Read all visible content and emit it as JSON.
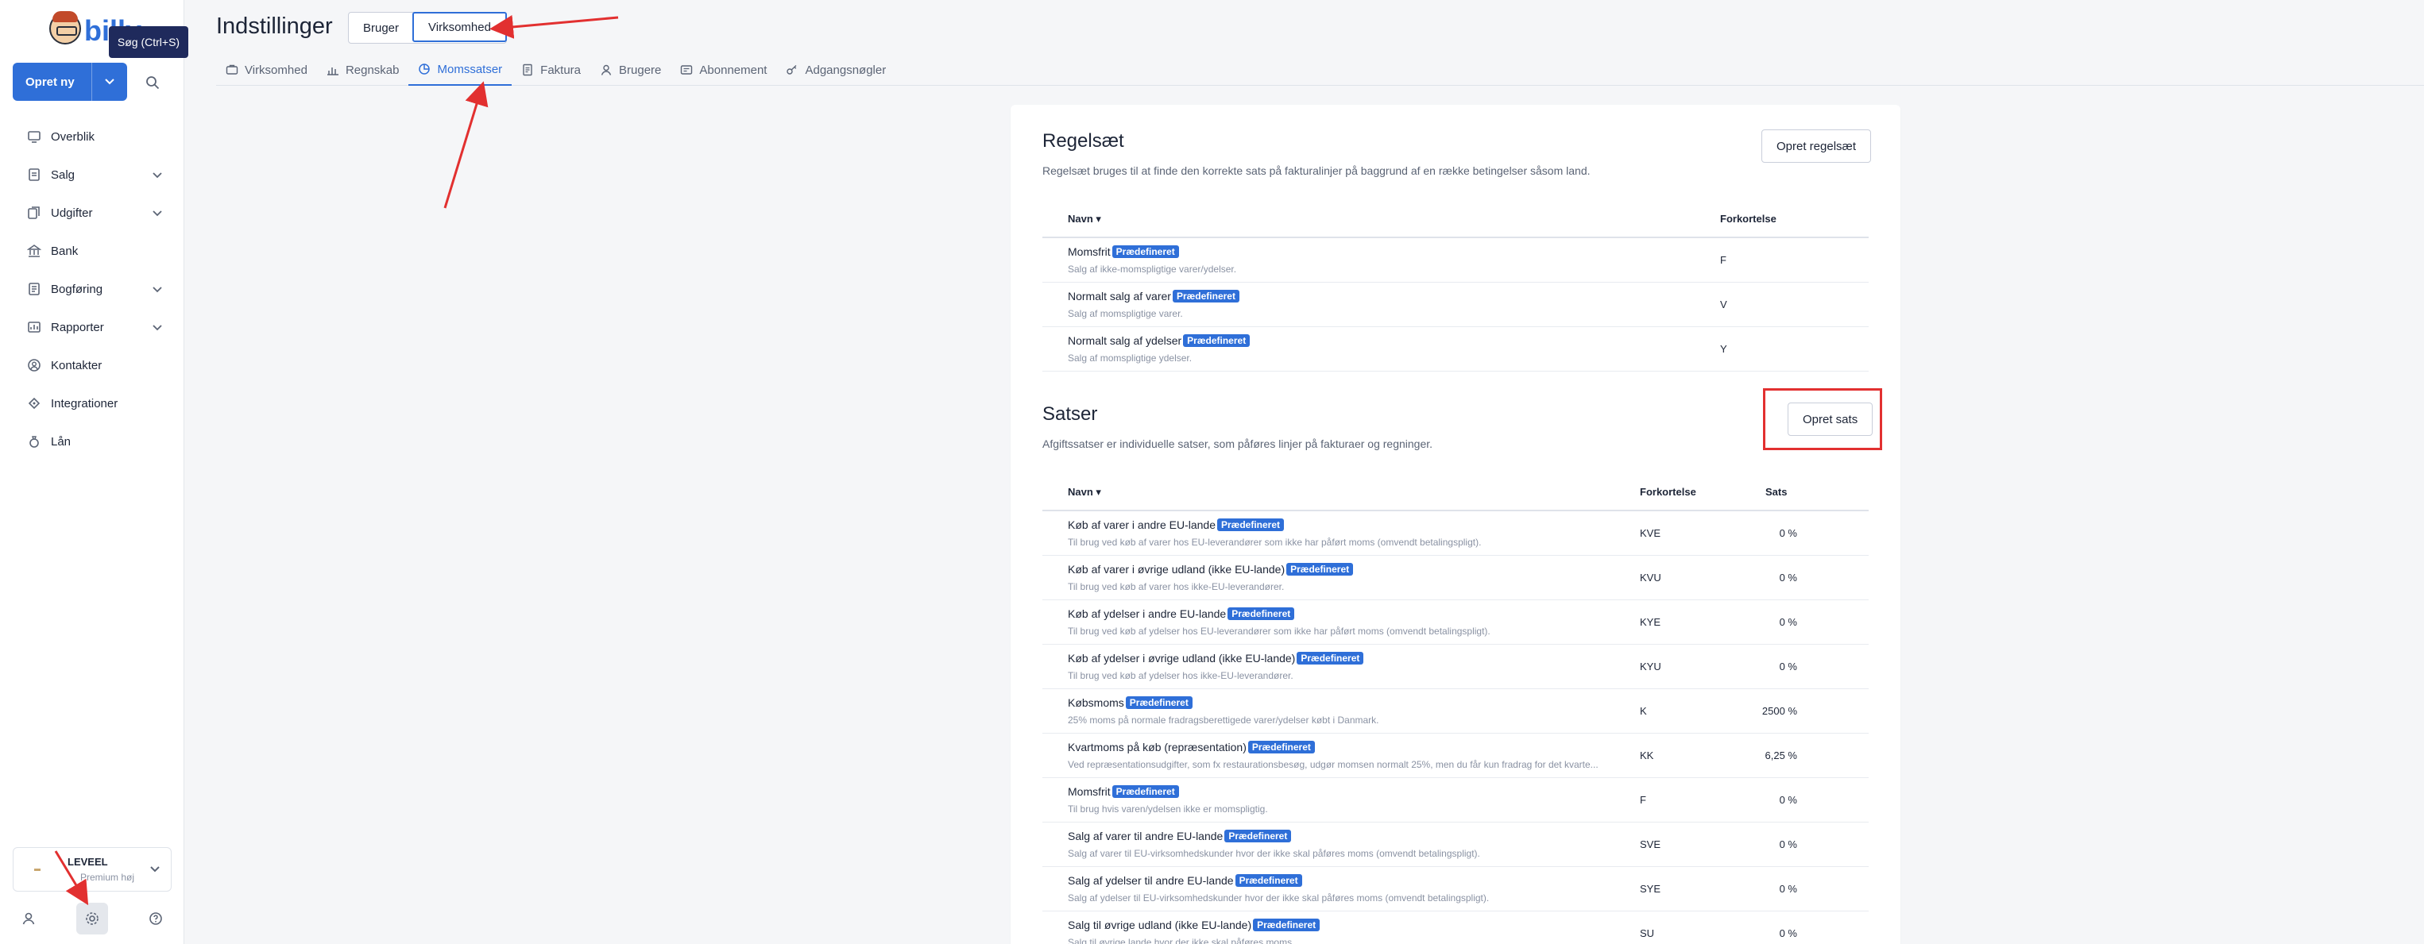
{
  "app": {
    "logo_text": "billy",
    "tooltip": "Søg (Ctrl+S)",
    "create_button": "Opret ny",
    "nav": [
      {
        "label": "Overblik",
        "icon": "overview-icon",
        "chevron": false
      },
      {
        "label": "Salg",
        "icon": "sales-icon",
        "chevron": true
      },
      {
        "label": "Udgifter",
        "icon": "expenses-icon",
        "chevron": true
      },
      {
        "label": "Bank",
        "icon": "bank-icon",
        "chevron": false
      },
      {
        "label": "Bogføring",
        "icon": "bookkeeping-icon",
        "chevron": true
      },
      {
        "label": "Rapporter",
        "icon": "reports-icon",
        "chevron": true
      },
      {
        "label": "Kontakter",
        "icon": "contacts-icon",
        "chevron": false
      },
      {
        "label": "Integrationer",
        "icon": "integrations-icon",
        "chevron": false
      },
      {
        "label": "Lån",
        "icon": "loan-icon",
        "chevron": false
      }
    ],
    "company": {
      "name": "LEVEEL",
      "plan": "Premium høj"
    }
  },
  "header": {
    "title": "Indstillinger",
    "scope_tabs": [
      {
        "label": "Bruger",
        "active": false
      },
      {
        "label": "Virksomhed",
        "active": true
      }
    ],
    "tabs": [
      {
        "label": "Virksomhed",
        "icon": "briefcase-icon",
        "active": false
      },
      {
        "label": "Regnskab",
        "icon": "chart-bars-icon",
        "active": false
      },
      {
        "label": "Momssatser",
        "icon": "pie-chart-icon",
        "active": true
      },
      {
        "label": "Faktura",
        "icon": "invoice-icon",
        "active": false
      },
      {
        "label": "Brugere",
        "icon": "user-icon",
        "active": false
      },
      {
        "label": "Abonnement",
        "icon": "subscription-icon",
        "active": false
      },
      {
        "label": "Adgangsnøgler",
        "icon": "key-icon",
        "active": false
      }
    ]
  },
  "rulesets": {
    "title": "Regelsæt",
    "description": "Regelsæt bruges til at finde den korrekte sats på fakturalinjer på baggrund af en række betingelser såsom land.",
    "button": "Opret regelsæt",
    "columns": {
      "name": "Navn",
      "abbr": "Forkortelse"
    },
    "rows": [
      {
        "name": "Momsfrit",
        "badge": "Prædefineret",
        "desc": "Salg af ikke-momspligtige varer/ydelser.",
        "abbr": "F"
      },
      {
        "name": "Normalt salg af varer",
        "badge": "Prædefineret",
        "desc": "Salg af momspligtige varer.",
        "abbr": "V"
      },
      {
        "name": "Normalt salg af ydelser",
        "badge": "Prædefineret",
        "desc": "Salg af momspligtige ydelser.",
        "abbr": "Y"
      }
    ]
  },
  "rates": {
    "title": "Satser",
    "description": "Afgiftssatser er individuelle satser, som påføres linjer på fakturaer og regninger.",
    "button": "Opret sats",
    "columns": {
      "name": "Navn",
      "abbr": "Forkortelse",
      "rate": "Sats"
    },
    "rows": [
      {
        "name": "Køb af varer i andre EU-lande",
        "badge": "Prædefineret",
        "desc": "Til brug ved køb af varer hos EU-leverandører som ikke har påført moms (omvendt betalingspligt).",
        "abbr": "KVE",
        "rate": "0 %"
      },
      {
        "name": "Køb af varer i øvrige udland (ikke EU-lande)",
        "badge": "Prædefineret",
        "desc": "Til brug ved køb af varer hos ikke-EU-leverandører.",
        "abbr": "KVU",
        "rate": "0 %"
      },
      {
        "name": "Køb af ydelser i andre EU-lande",
        "badge": "Prædefineret",
        "desc": "Til brug ved køb af ydelser hos EU-leverandører som ikke har påført moms (omvendt betalingspligt).",
        "abbr": "KYE",
        "rate": "0 %"
      },
      {
        "name": "Køb af ydelser i øvrige udland (ikke EU-lande)",
        "badge": "Prædefineret",
        "desc": "Til brug ved køb af ydelser hos ikke-EU-leverandører.",
        "abbr": "KYU",
        "rate": "0 %"
      },
      {
        "name": "Købsmoms",
        "badge": "Prædefineret",
        "desc": "25% moms på normale fradragsberettigede varer/ydelser købt i Danmark.",
        "abbr": "K",
        "rate": "2500 %"
      },
      {
        "name": "Kvartmoms på køb (repræsentation)",
        "badge": "Prædefineret",
        "desc": "Ved repræsentationsudgifter, som fx restaurationsbesøg, udgør momsen normalt 25%, men du får kun fradrag for det kvarte...",
        "abbr": "KK",
        "rate": "6,25 %"
      },
      {
        "name": "Momsfrit",
        "badge": "Prædefineret",
        "desc": "Til brug hvis varen/ydelsen ikke er momspligtig.",
        "abbr": "F",
        "rate": "0 %"
      },
      {
        "name": "Salg af varer til andre EU-lande",
        "badge": "Prædefineret",
        "desc": "Salg af varer til EU-virksomhedskunder hvor der ikke skal påføres moms (omvendt betalingspligt).",
        "abbr": "SVE",
        "rate": "0 %"
      },
      {
        "name": "Salg af ydelser til andre EU-lande",
        "badge": "Prædefineret",
        "desc": "Salg af ydelser til EU-virksomhedskunder hvor der ikke skal påføres moms (omvendt betalingspligt).",
        "abbr": "SYE",
        "rate": "0 %"
      },
      {
        "name": "Salg til øvrige udland (ikke EU-lande)",
        "badge": "Prædefineret",
        "desc": "Salg til øvrige lande hvor der ikke skal påføres moms.",
        "abbr": "SU",
        "rate": "0 %"
      }
    ]
  },
  "colors": {
    "accent": "#2f6fd8",
    "annotation": "#e23030"
  }
}
